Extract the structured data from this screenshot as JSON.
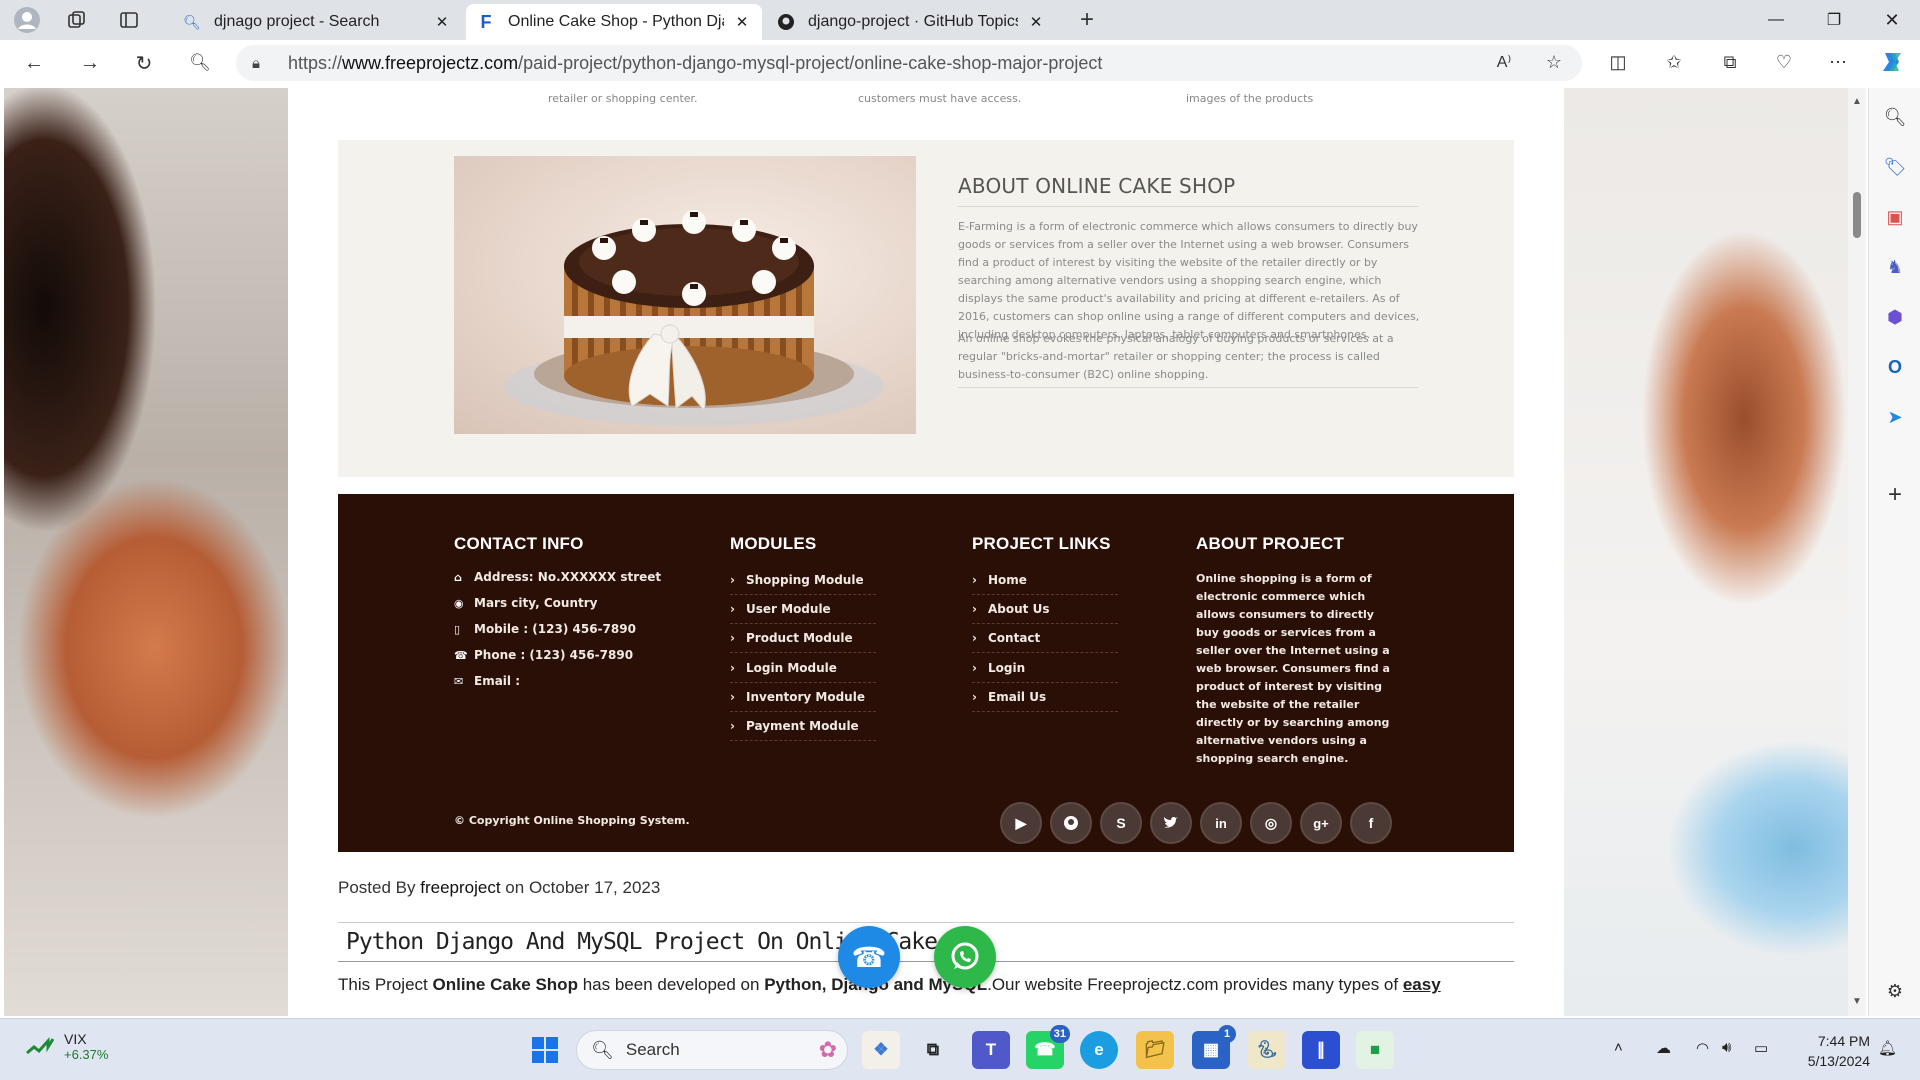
{
  "browser": {
    "tabs": [
      {
        "label": "djnago project - Search",
        "favicon": "search-icon"
      },
      {
        "label": "Online Cake Shop - Python Django",
        "favicon": "freeprojectz-icon"
      },
      {
        "label": "django-project · GitHub Topics",
        "favicon": "github-icon"
      }
    ],
    "url_prefix": "https://",
    "url_domain": "www.freeprojectz.com",
    "url_path": "/paid-project/python-django-mysql-project/online-cake-shop-major-project"
  },
  "page": {
    "feature_captions": [
      "retailer or shopping center.",
      "customers must have access.",
      "images of the products"
    ],
    "about": {
      "title": "ABOUT ONLINE CAKE SHOP",
      "para1": "E-Farming is a form of electronic commerce which allows consumers to directly buy goods or services from a seller over the Internet using a web browser. Consumers find a product of interest by visiting the website of the retailer directly or by searching among alternative vendors using a shopping search engine, which displays the same product's availability and pricing at different e-retailers. As of 2016, customers can shop online using a range of different computers and devices, including desktop computers, laptops, tablet computers and smartphones.",
      "para2": "An online shop evokes the physical analogy of buying products or services at a regular \"bricks-and-mortar\" retailer or shopping center; the process is called business-to-consumer (B2C) online shopping."
    },
    "footer": {
      "contact_heading": "CONTACT INFO",
      "contact": {
        "address": "Address: No.XXXXXX street",
        "city": "Mars city, Country",
        "mobile": "Mobile : (123) 456-7890",
        "phone": "Phone : (123) 456-7890",
        "email": "Email :"
      },
      "modules_heading": "MODULES",
      "modules": [
        "Shopping Module",
        "User Module",
        "Product Module",
        "Login Module",
        "Inventory Module",
        "Payment Module"
      ],
      "links_heading": "PROJECT LINKS",
      "links": [
        "Home",
        "About Us",
        "Contact",
        "Login",
        "Email Us"
      ],
      "about_heading": "ABOUT PROJECT",
      "about_text": "Online shopping is a form of electronic commerce which allows consumers to directly buy goods or services from a seller over the Internet using a web browser. Consumers find a product of interest by visiting the website of the retailer directly or by searching among alternative vendors using a shopping search engine.",
      "copyright": "© Copyright Online Shopping System.",
      "social_icons": [
        "youtube-icon",
        "github-icon",
        "skype-icon",
        "twitter-icon",
        "linkedin-icon",
        "dribbble-icon",
        "google-plus-icon",
        "facebook-icon"
      ]
    },
    "posted_by_prefix": "Posted By",
    "posted_by_author": "freeproject",
    "posted_on_prefix": "on",
    "posted_date": "October 17, 2023",
    "post_title": "Python Django And MySQL Project On Online Cake Sh",
    "post_body": {
      "t1": "This Project ",
      "b1": "Online Cake Shop",
      "t2": " has been developed on ",
      "b2": "Python, Django and MySQL",
      "t3": ".Our website Freeprojectz.com provides many types of ",
      "u1": "easy"
    }
  },
  "taskbar": {
    "ticker_name": "VIX",
    "ticker_change": "+6.37%",
    "search_label": "Search",
    "whatsapp_badge": "31",
    "store_badge": "1",
    "time": "7:44 PM",
    "date": "5/13/2024"
  }
}
